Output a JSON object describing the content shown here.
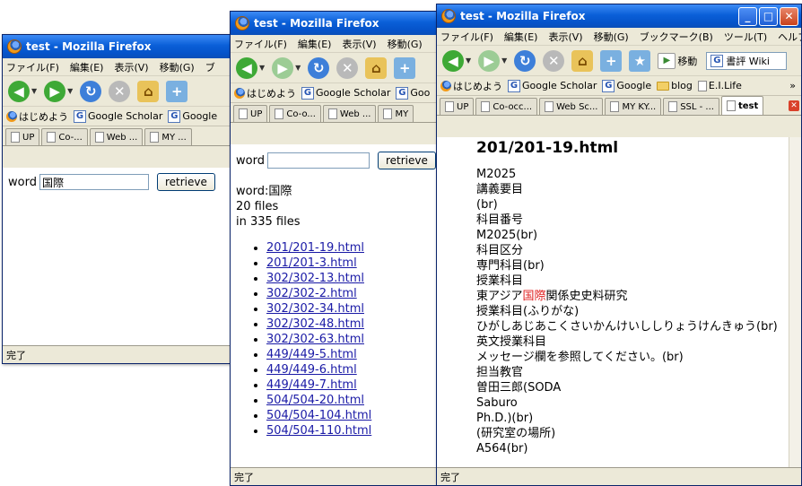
{
  "win1": {
    "title": "test - Mozilla Firefox",
    "menu": [
      "ファイル(F)",
      "編集(E)",
      "表示(V)",
      "移動(G)",
      "ブ"
    ],
    "bookmarks": [
      {
        "label": "はじめよう",
        "icon": "firefox-icon"
      },
      {
        "label": "Google Scholar",
        "icon": "google-icon"
      },
      {
        "label": "Google",
        "icon": "google-icon"
      }
    ],
    "tabs": [
      "UP",
      "Co-...",
      "Web ...",
      "MY ..."
    ],
    "word_label": "word",
    "word_value": "国際",
    "retrieve_label": "retrieve",
    "status": "完了"
  },
  "win2": {
    "title": "test - Mozilla Firefox",
    "menu": [
      "ファイル(F)",
      "編集(E)",
      "表示(V)",
      "移動(G)"
    ],
    "bookmarks": [
      {
        "label": "はじめよう",
        "icon": "firefox-icon"
      },
      {
        "label": "Google Scholar",
        "icon": "google-icon"
      },
      {
        "label": "Goo",
        "icon": "google-icon"
      }
    ],
    "tabs": [
      "UP",
      "Co-o...",
      "Web ...",
      "MY"
    ],
    "word_label": "word",
    "word_value": "",
    "retrieve_label": "retrieve",
    "result_word": "word:国際",
    "result_files": "20 files",
    "result_total": "in 335 files",
    "links": [
      "201/201-19.html",
      "201/201-3.html",
      "302/302-13.html",
      "302/302-2.html",
      "302/302-34.html",
      "302/302-48.html",
      "302/302-63.html",
      "449/449-5.html",
      "449/449-6.html",
      "449/449-7.html",
      "504/504-20.html",
      "504/504-104.html",
      "504/504-110.html"
    ],
    "status": "完了"
  },
  "win3": {
    "title": "test - Mozilla Firefox",
    "menu": [
      "ファイル(F)",
      "編集(E)",
      "表示(V)",
      "移動(G)",
      "ブックマーク(B)",
      "ツール(T)",
      "ヘルプ(H)"
    ],
    "nav_go": "移動",
    "search_text": "書評 Wiki",
    "bookmarks": [
      {
        "label": "はじめよう",
        "icon": "firefox-icon"
      },
      {
        "label": "Google Scholar",
        "icon": "google-icon"
      },
      {
        "label": "Google",
        "icon": "google-icon"
      },
      {
        "label": "blog",
        "icon": "folder-icon"
      },
      {
        "label": "E.I.Life",
        "icon": "page-icon"
      }
    ],
    "bookmarks_more": "»",
    "tabs": [
      "UP",
      "Co-occ...",
      "Web Sc...",
      "MY KY...",
      "SSL - ...",
      "test"
    ],
    "doc_title": "201/201-19.html",
    "doc_lines": [
      "M2025",
      "講義要目",
      "(br)",
      "科目番号",
      "M2025(br)",
      "科目区分",
      "専門科目(br)",
      "授業科目"
    ],
    "doc_line_hl_pre": "東アジア",
    "doc_line_hl": "国際",
    "doc_line_hl_post": "関係史史料研究",
    "doc_lines_after": [
      "授業科目(ふりがな)",
      "ひがしあじあこくさいかんけいししりょうけんきゅう(br)",
      "英文授業科目",
      "メッセージ欄を参照してください。(br)",
      "担当教官",
      "曽田三郎(SODA",
      "Saburo",
      "Ph.D.)(br)",
      "(研究室の場所)",
      "A564(br)"
    ],
    "status": "完了"
  }
}
